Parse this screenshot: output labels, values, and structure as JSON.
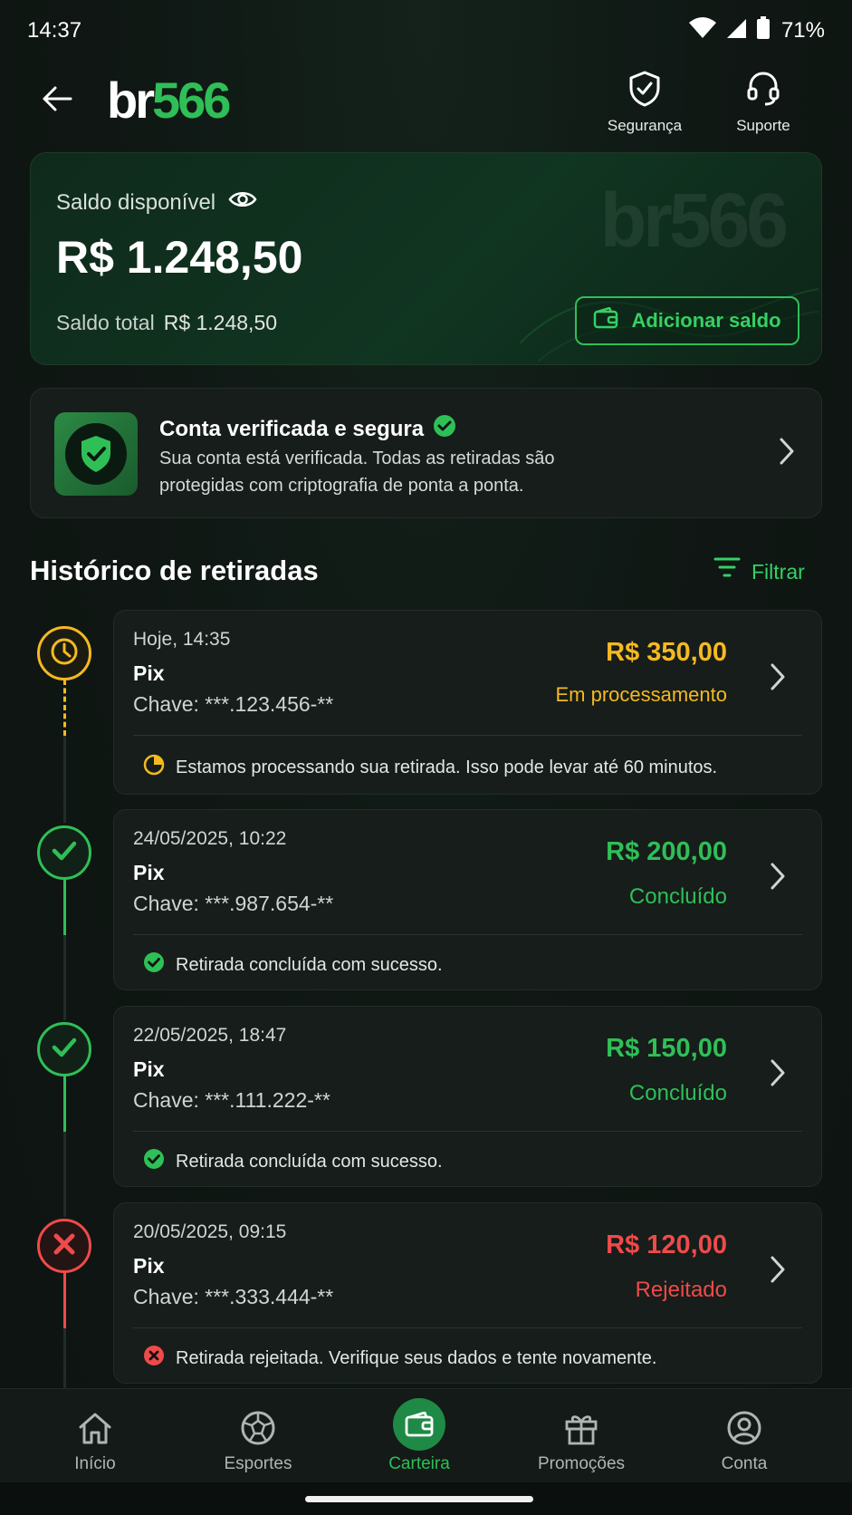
{
  "status_bar": {
    "time": "14:37",
    "battery": "71%"
  },
  "header": {
    "logo_text": "br",
    "logo_number": "566",
    "security_label": "Segurança",
    "support_label": "Suporte"
  },
  "balance": {
    "label": "Saldo disponível",
    "value": "R$ 1.248,50",
    "total_label": "Saldo total",
    "total_value": "R$ 1.248,50",
    "watermark": "br566",
    "add_button": "Adicionar saldo"
  },
  "verification": {
    "title": "Conta verificada e segura",
    "description": "Sua conta está verificada. Todas as retiradas são protegidas com criptografia de ponta a ponta."
  },
  "history": {
    "title": "Histórico de retiradas",
    "filter_label": "Filtrar",
    "items": [
      {
        "date": "Hoje, 14:35",
        "method": "Pix",
        "key": "Chave: ***.123.456-**",
        "amount": "R$ 350,00",
        "status": "Em processamento",
        "note": "Estamos processando sua retirada. Isso pode levar até 60 minutos.",
        "state": "processing",
        "color": "#f5b921"
      },
      {
        "date": "24/05/2025, 10:22",
        "method": "Pix",
        "key": "Chave: ***.987.654-**",
        "amount": "R$ 200,00",
        "status": "Concluído",
        "note": "Retirada concluída com sucesso.",
        "state": "success",
        "color": "#2fbf57"
      },
      {
        "date": "22/05/2025, 18:47",
        "method": "Pix",
        "key": "Chave: ***.111.222-**",
        "amount": "R$ 150,00",
        "status": "Concluído",
        "note": "Retirada concluída com sucesso.",
        "state": "success",
        "color": "#2fbf57"
      },
      {
        "date": "20/05/2025, 09:15",
        "method": "Pix",
        "key": "Chave: ***.333.444-**",
        "amount": "R$ 120,00",
        "status": "Rejeitado",
        "note": "Retirada rejeitada. Verifique seus dados e tente novamente.",
        "state": "rejected",
        "color": "#ef4a4a"
      }
    ]
  },
  "bottom_nav": {
    "items": [
      {
        "label": "Início",
        "icon": "home-icon"
      },
      {
        "label": "Esportes",
        "icon": "soccer-ball-icon"
      },
      {
        "label": "Carteira",
        "icon": "wallet-icon",
        "active": true
      },
      {
        "label": "Promoções",
        "icon": "gift-icon"
      },
      {
        "label": "Conta",
        "icon": "user-icon"
      }
    ]
  },
  "colors": {
    "accent": "#2fbf57",
    "processing": "#f5b921",
    "rejected": "#ef4a4a",
    "background": "#0f1613"
  }
}
